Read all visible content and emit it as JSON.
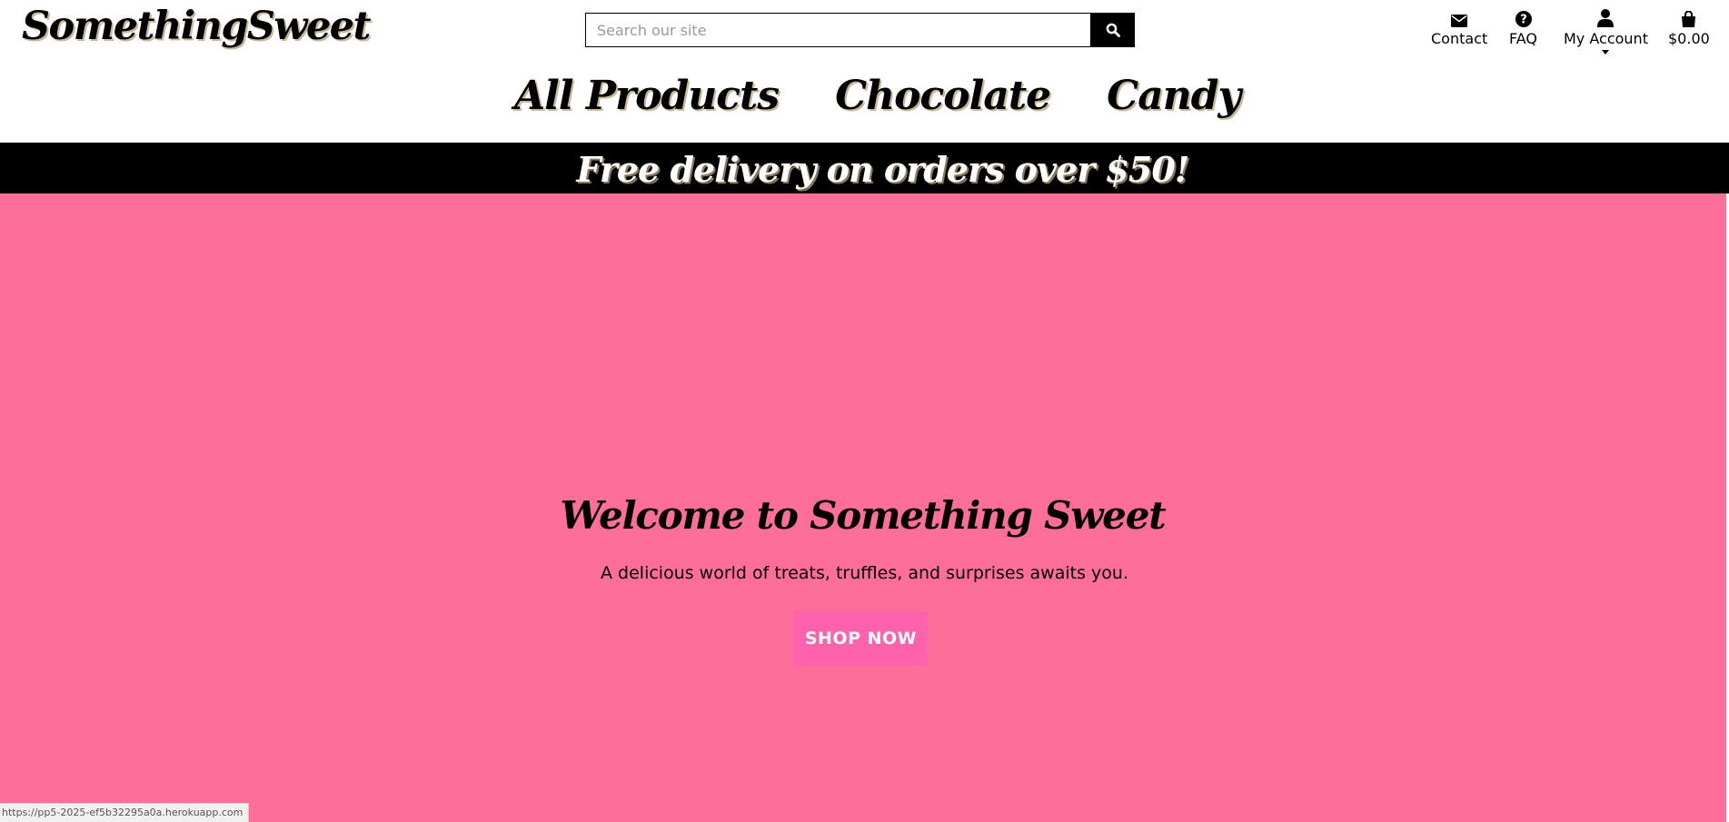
{
  "header": {
    "logo": "SomethingSweet",
    "search": {
      "placeholder": "Search our site",
      "value": ""
    },
    "util_nav": [
      {
        "label": "Contact",
        "icon": "envelope-icon"
      },
      {
        "label": "FAQ",
        "icon": "question-circle-icon"
      },
      {
        "label": "My Account",
        "icon": "user-icon"
      },
      {
        "label": "$0.00",
        "icon": "shopping-bag-icon"
      }
    ]
  },
  "main_nav": [
    "All Products",
    "Chocolate",
    "Candy"
  ],
  "promo": {
    "text": "Free delivery on orders over $50!"
  },
  "hero": {
    "title": "Welcome to Something Sweet",
    "subtitle": "A delicious world of treats, truffles, and surprises awaits you.",
    "cta_label": "SHOP NOW",
    "background": "#fe6e9b",
    "cta_color": "#ff62ad"
  },
  "status_bar": {
    "url": "https://pp5-2025-ef5b32295a0a.herokuapp.com"
  }
}
